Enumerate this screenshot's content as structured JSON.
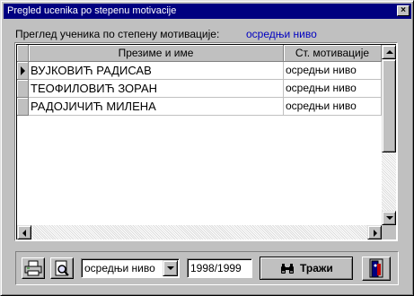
{
  "window": {
    "title": "Pregled ucenika po stepenu motivacije",
    "close_glyph": "×"
  },
  "header": {
    "label": "Преглед ученика по степену мотивације:",
    "value": "осредњи ниво"
  },
  "grid": {
    "columns": [
      "Презиме и име",
      "Ст. мотивације"
    ],
    "rows": [
      {
        "name": "ВУЈКОВИЋ РАДИСАВ",
        "level": "осредњи ниво"
      },
      {
        "name": "ТЕОФИЛОВИЋ ЗОРАН",
        "level": "осредњи ниво"
      },
      {
        "name": "РАДОЈИЧИЋ МИЛЕНА",
        "level": "осредњи ниво"
      }
    ]
  },
  "toolbar": {
    "motivation_select": "осредњи ниво",
    "year": "1998/1999",
    "search_label": "Тражи"
  },
  "icons": {
    "print": "printer-icon",
    "preview": "print-preview-icon",
    "search": "binoculars-icon",
    "exit": "exit-door-icon"
  },
  "colors": {
    "titlebar": "#000080",
    "accent_text": "#0000c0",
    "face": "#c0c0c0"
  }
}
